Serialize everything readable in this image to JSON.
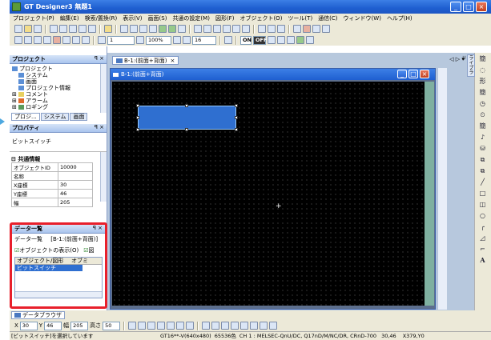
{
  "window": {
    "title": "GT Designer3 無題1",
    "minimize": "_",
    "maximize": "□",
    "close": "×"
  },
  "menu": [
    "プロジェクト(P)",
    "編集(E)",
    "検索/置換(R)",
    "表示(V)",
    "画面(S)",
    "共通の設定(M)",
    "図形(F)",
    "オブジェクト(O)",
    "ツール(T)",
    "通信(C)",
    "ウィンドウ(W)",
    "ヘルプ(H)"
  ],
  "toolbar": {
    "layer_value": "1",
    "zoom_value": "100%",
    "font_size": "16",
    "on_label": "ON",
    "off_label": "OFF"
  },
  "project_panel": {
    "title": "プロジェクト",
    "pin": "ꟼ ×",
    "tree": [
      "プロジェクト",
      "システム",
      "画面",
      "プロジェクト情報",
      "コメント",
      "アラーム",
      "ロギング"
    ],
    "tabs": [
      "プロジ...",
      "システム",
      "画面"
    ]
  },
  "property_panel": {
    "title": "プロパティ",
    "pin": "ꟼ ×",
    "object_name": "ビットスイッチ",
    "section": "共通情報",
    "rows": [
      {
        "key": "オブジェクトID",
        "value": "10000"
      },
      {
        "key": "名称",
        "value": ""
      },
      {
        "key": "X座標",
        "value": "30"
      },
      {
        "key": "Y座標",
        "value": "46"
      },
      {
        "key": "幅",
        "value": "205"
      }
    ]
  },
  "data_panel": {
    "title": "データ一覧",
    "pin": "ꟼ ×",
    "label": "データ一覧",
    "screen": "[B-1:(前面+背面)]",
    "check_object": "オブジェクトの表示(O)",
    "check_shape_prefix": "図",
    "col_object": "オブジェクト/図形",
    "col_other": "オブミ",
    "selected_row": "ビットスイッチ"
  },
  "editor": {
    "tab_label": "B-1:(前面+背面)",
    "window_label": "B-1:(前面+背面)",
    "tab_nav": "◁ ▷ ▾ ×"
  },
  "right_toolbar": {
    "side_tab": "ライブラリ",
    "items": [
      "簡",
      "◌",
      "形",
      "簡",
      "◷",
      "⏲",
      "簡",
      "♪",
      "⛁",
      "⧉",
      "⧉",
      "╱",
      "□",
      "◫",
      "○",
      "╭",
      "◿",
      "⌐",
      "A"
    ]
  },
  "bottom": {
    "data_browser_tab": "データブラウザ",
    "x_label": "X",
    "x_value": "30",
    "y_label": "Y",
    "y_value": "46",
    "w_label": "幅",
    "w_value": "205",
    "h_label": "高さ",
    "h_value": "50"
  },
  "status": {
    "left": "[ビットスイッチ]を選択しています",
    "device": "GT16**-V(640x480)",
    "colors": "65536色",
    "channel": "CH 1 : MELSEC-QnU/DC, Q17nD/M/NC/DR, CRnD-700",
    "cursor": "30,46",
    "coord": "X379,Y0"
  },
  "colors": {
    "title_blue": "#1f5fd0",
    "highlight_red": "#e8202b",
    "selection_blue": "#2f6fd0",
    "dock_bg": "#ece9d8"
  }
}
